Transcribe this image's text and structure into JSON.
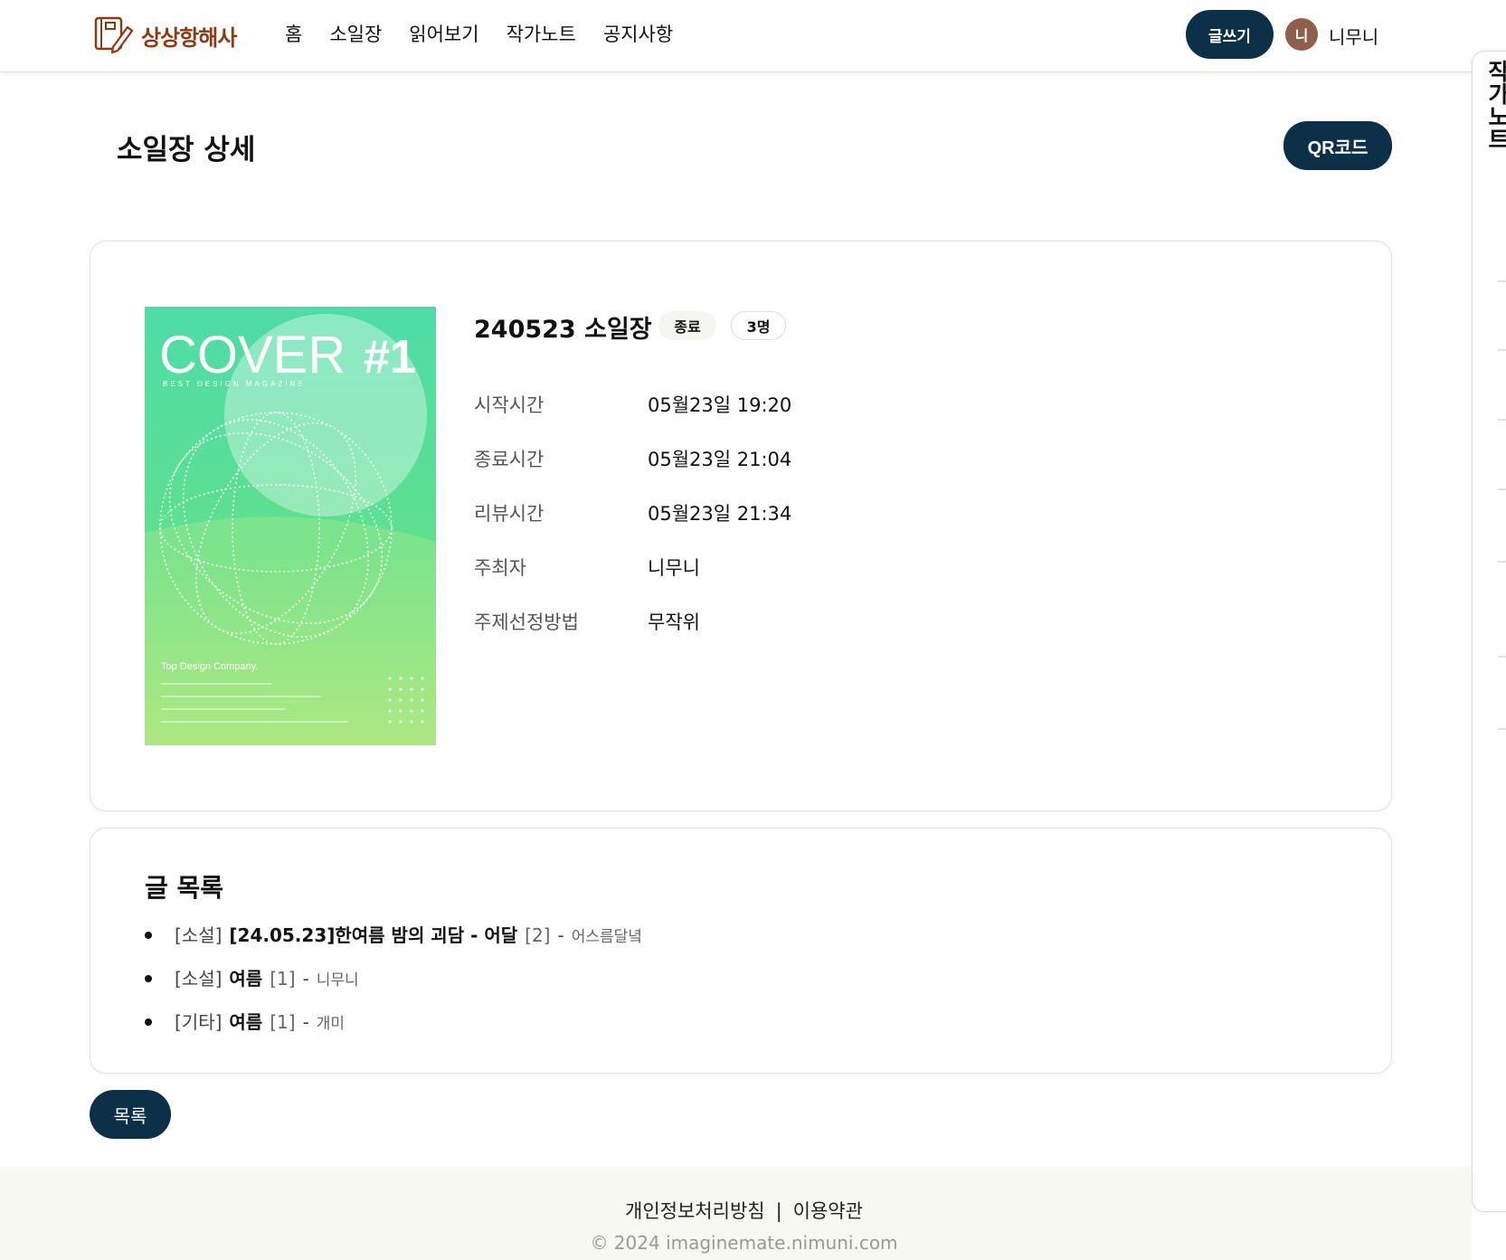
{
  "header": {
    "logo_text": "상상항해사",
    "nav": [
      "홈",
      "소일장",
      "읽어보기",
      "작가노트",
      "공지사항"
    ],
    "write_label": "글쓰기",
    "avatar_initial": "니",
    "username": "니무니"
  },
  "side_panel": {
    "label": "작가노트"
  },
  "page": {
    "title": "소일장 상세",
    "qr_label": "QR코드"
  },
  "event": {
    "title": "240523 소일장",
    "status": "종료",
    "participants": "3명",
    "cover_text": {
      "headline": "COVER",
      "number": "#1",
      "subtitle": "BEST DESIGN MAGAZINE",
      "company": "Top Design Company."
    },
    "info": [
      {
        "label": "시작시간",
        "value": "05월23일 19:20"
      },
      {
        "label": "종료시간",
        "value": "05월23일 21:04"
      },
      {
        "label": "리뷰시간",
        "value": "05월23일 21:34"
      },
      {
        "label": "주최자",
        "value": "니무니"
      },
      {
        "label": "주제선정방법",
        "value": "무작위"
      }
    ]
  },
  "posts": {
    "title": "글 목록",
    "items": [
      {
        "category": "[소설]",
        "title": "[24.05.23]한여름 밤의 괴담 - 어달",
        "count": "[2]",
        "dash": "-",
        "author": "어스름달녘"
      },
      {
        "category": "[소설]",
        "title": "여름",
        "count": "[1]",
        "dash": "-",
        "author": "니무니"
      },
      {
        "category": "[기타]",
        "title": "여름",
        "count": "[1]",
        "dash": "-",
        "author": "개미"
      }
    ]
  },
  "list_button": "목록",
  "footer": {
    "privacy": "개인정보처리방침",
    "separator": "|",
    "terms": "이용약관",
    "copyright": "© 2024 imaginemate.nimuni.com"
  },
  "colors": {
    "primary": "#0b3048",
    "brand": "#8a3b12",
    "avatar": "#8f5f4b",
    "footer_bg": "#f8f8f3"
  }
}
